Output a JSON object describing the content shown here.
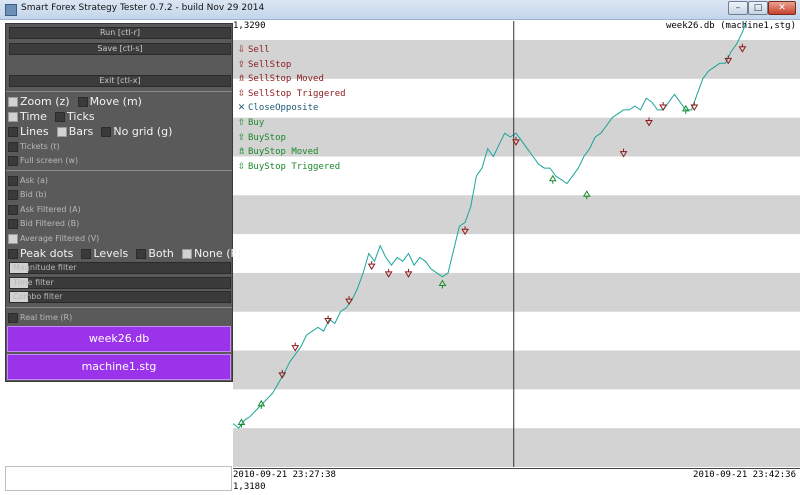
{
  "window": {
    "title": "Smart Forex Strategy Tester 0.7.2 - build Nov 29 2014",
    "minimize_glyph": "–",
    "maximize_glyph": "□",
    "close_glyph": "✕"
  },
  "panel": {
    "run_label": "Run [ctl-r]",
    "save_label": "Save [ctl-s]",
    "exit_label": "Exit [ctl-x]",
    "options_big": [
      [
        {
          "label": "Zoom (z)",
          "checked": true
        },
        {
          "label": "Move (m)",
          "checked": false
        }
      ],
      [
        {
          "label": "Time",
          "checked": true
        },
        {
          "label": "Ticks",
          "checked": false
        }
      ],
      [
        {
          "label": "Lines",
          "checked": false
        },
        {
          "label": "Bars",
          "checked": true
        },
        {
          "label": "No grid (g)",
          "checked": false
        }
      ]
    ],
    "options_small_a": [
      {
        "label": "Tickets (t)",
        "checked": false
      },
      {
        "label": "Full screen (w)",
        "checked": false
      }
    ],
    "options_small_b": [
      {
        "label": "Ask (a)",
        "checked": false
      },
      {
        "label": "Bid (b)",
        "checked": false
      },
      {
        "label": "Ask Filtered (A)",
        "checked": false
      },
      {
        "label": "Bid Filtered (B)",
        "checked": false
      },
      {
        "label": "Average Filtered (V)",
        "checked": true
      }
    ],
    "peak_row": [
      {
        "label": "Peak dots",
        "checked": false
      },
      {
        "label": "Levels",
        "checked": false
      },
      {
        "label": "Both",
        "checked": false
      },
      {
        "label": "None (P)",
        "checked": true
      }
    ],
    "filters": [
      {
        "label": "Magnitude filter",
        "level": 0.08
      },
      {
        "label": "Time filter",
        "level": 0.08
      },
      {
        "label": "Combo filter",
        "level": 0.08
      }
    ],
    "realtime": {
      "label": "Real time (R)",
      "checked": false
    },
    "files": [
      "week26.db",
      "machine1.stg"
    ]
  },
  "chart_data": {
    "type": "line",
    "title": "week26.db (machine1,stg)",
    "y_max_label": "1,3290",
    "y_min_label": "1,3180",
    "ylim": [
      1.318,
      1.329
    ],
    "x_start_label": "2010-09-21 23:27:38",
    "x_end_label": "2010-09-21 23:42:36",
    "grid": true,
    "line_color": "#1aa59a",
    "sell_color": "#8b1a1a",
    "buy_color": "#1a8a2a",
    "legend": [
      {
        "label": "Sell",
        "kind": "sell",
        "glyph": "sell"
      },
      {
        "label": "SellStop",
        "kind": "sell",
        "glyph": "stop"
      },
      {
        "label": "SellStop Moved",
        "kind": "sell",
        "glyph": "moved"
      },
      {
        "label": "SellStop Triggered",
        "kind": "sell",
        "glyph": "trig"
      },
      {
        "label": "CloseOpposite",
        "kind": "close",
        "glyph": "close"
      },
      {
        "label": "Buy",
        "kind": "buy",
        "glyph": "buy"
      },
      {
        "label": "BuyStop",
        "kind": "buy",
        "glyph": "stop"
      },
      {
        "label": "BuyStop Moved",
        "kind": "buy",
        "glyph": "moved"
      },
      {
        "label": "BuyStop Triggered",
        "kind": "buy",
        "glyph": "trig"
      }
    ],
    "cursor_t": 0.496,
    "series": [
      {
        "values": [
          [
            0.0,
            1.31912
          ],
          [
            0.01,
            1.319
          ],
          [
            0.02,
            1.3192
          ],
          [
            0.03,
            1.3193
          ],
          [
            0.05,
            1.3196
          ],
          [
            0.07,
            1.3199
          ],
          [
            0.09,
            1.3204
          ],
          [
            0.1,
            1.3207
          ],
          [
            0.12,
            1.3211
          ],
          [
            0.13,
            1.3214
          ],
          [
            0.15,
            1.3216
          ],
          [
            0.16,
            1.3215
          ],
          [
            0.17,
            1.3218
          ],
          [
            0.18,
            1.3217
          ],
          [
            0.19,
            1.322
          ],
          [
            0.2,
            1.3221
          ],
          [
            0.21,
            1.3223
          ],
          [
            0.22,
            1.3226
          ],
          [
            0.23,
            1.323
          ],
          [
            0.24,
            1.3235
          ],
          [
            0.25,
            1.3233
          ],
          [
            0.26,
            1.3237
          ],
          [
            0.27,
            1.3234
          ],
          [
            0.28,
            1.3232
          ],
          [
            0.29,
            1.3234
          ],
          [
            0.3,
            1.3233
          ],
          [
            0.31,
            1.3235
          ],
          [
            0.32,
            1.3232
          ],
          [
            0.33,
            1.3234
          ],
          [
            0.34,
            1.3233
          ],
          [
            0.35,
            1.3231
          ],
          [
            0.36,
            1.323
          ],
          [
            0.37,
            1.3229
          ],
          [
            0.38,
            1.323
          ],
          [
            0.39,
            1.3236
          ],
          [
            0.4,
            1.3242
          ],
          [
            0.41,
            1.3243
          ],
          [
            0.42,
            1.3247
          ],
          [
            0.43,
            1.3255
          ],
          [
            0.44,
            1.3257
          ],
          [
            0.45,
            1.3262
          ],
          [
            0.46,
            1.326
          ],
          [
            0.47,
            1.3263
          ],
          [
            0.48,
            1.3266
          ],
          [
            0.49,
            1.3265
          ],
          [
            0.5,
            1.3266
          ],
          [
            0.51,
            1.3264
          ],
          [
            0.52,
            1.3262
          ],
          [
            0.53,
            1.326
          ],
          [
            0.54,
            1.3258
          ],
          [
            0.55,
            1.3257
          ],
          [
            0.56,
            1.3257
          ],
          [
            0.57,
            1.3255
          ],
          [
            0.58,
            1.3254
          ],
          [
            0.59,
            1.3253
          ],
          [
            0.6,
            1.3255
          ],
          [
            0.61,
            1.3257
          ],
          [
            0.62,
            1.326
          ],
          [
            0.63,
            1.3262
          ],
          [
            0.64,
            1.3265
          ],
          [
            0.65,
            1.3266
          ],
          [
            0.66,
            1.3268
          ],
          [
            0.67,
            1.327
          ],
          [
            0.68,
            1.3271
          ],
          [
            0.69,
            1.3272
          ],
          [
            0.7,
            1.3272
          ],
          [
            0.71,
            1.3273
          ],
          [
            0.72,
            1.3272
          ],
          [
            0.73,
            1.3275
          ],
          [
            0.74,
            1.3274
          ],
          [
            0.75,
            1.3272
          ],
          [
            0.76,
            1.3272
          ],
          [
            0.77,
            1.3274
          ],
          [
            0.78,
            1.3276
          ],
          [
            0.79,
            1.3274
          ],
          [
            0.8,
            1.3272
          ],
          [
            0.81,
            1.3272
          ],
          [
            0.82,
            1.3276
          ],
          [
            0.83,
            1.328
          ],
          [
            0.84,
            1.3282
          ],
          [
            0.85,
            1.3283
          ],
          [
            0.86,
            1.3284
          ],
          [
            0.87,
            1.3284
          ],
          [
            0.88,
            1.3287
          ],
          [
            0.89,
            1.3289
          ],
          [
            0.9,
            1.3292
          ],
          [
            0.91,
            1.3296
          ],
          [
            0.92,
            1.33
          ],
          [
            0.93,
            1.3304
          ],
          [
            0.94,
            1.3309
          ],
          [
            0.95,
            1.3315
          ],
          [
            0.96,
            1.332
          ],
          [
            0.965,
            1.3323
          ],
          [
            0.98,
            1.3319
          ],
          [
            0.99,
            1.3312
          ],
          [
            1.0,
            1.3308
          ]
        ]
      }
    ],
    "markers": [
      {
        "t": 0.015,
        "v": 1.31912,
        "kind": "buy"
      },
      {
        "t": 0.05,
        "v": 1.3196,
        "kind": "buy"
      },
      {
        "t": 0.087,
        "v": 1.3204,
        "kind": "sell"
      },
      {
        "t": 0.11,
        "v": 1.3211,
        "kind": "sell"
      },
      {
        "t": 0.168,
        "v": 1.3218,
        "kind": "sell"
      },
      {
        "t": 0.205,
        "v": 1.3223,
        "kind": "sell"
      },
      {
        "t": 0.245,
        "v": 1.3232,
        "kind": "sell"
      },
      {
        "t": 0.275,
        "v": 1.323,
        "kind": "sell"
      },
      {
        "t": 0.31,
        "v": 1.323,
        "kind": "sell"
      },
      {
        "t": 0.37,
        "v": 1.3227,
        "kind": "buy"
      },
      {
        "t": 0.41,
        "v": 1.3241,
        "kind": "sell"
      },
      {
        "t": 0.5,
        "v": 1.3264,
        "kind": "sell"
      },
      {
        "t": 0.565,
        "v": 1.3254,
        "kind": "buy"
      },
      {
        "t": 0.625,
        "v": 1.325,
        "kind": "buy"
      },
      {
        "t": 0.69,
        "v": 1.3261,
        "kind": "sell"
      },
      {
        "t": 0.735,
        "v": 1.3269,
        "kind": "sell"
      },
      {
        "t": 0.76,
        "v": 1.3273,
        "kind": "sell"
      },
      {
        "t": 0.8,
        "v": 1.3272,
        "kind": "buy"
      },
      {
        "t": 0.815,
        "v": 1.3273,
        "kind": "sell"
      },
      {
        "t": 0.875,
        "v": 1.3285,
        "kind": "sell"
      },
      {
        "t": 0.9,
        "v": 1.3288,
        "kind": "sell"
      },
      {
        "t": 0.955,
        "v": 1.3319,
        "kind": "sell"
      }
    ]
  }
}
